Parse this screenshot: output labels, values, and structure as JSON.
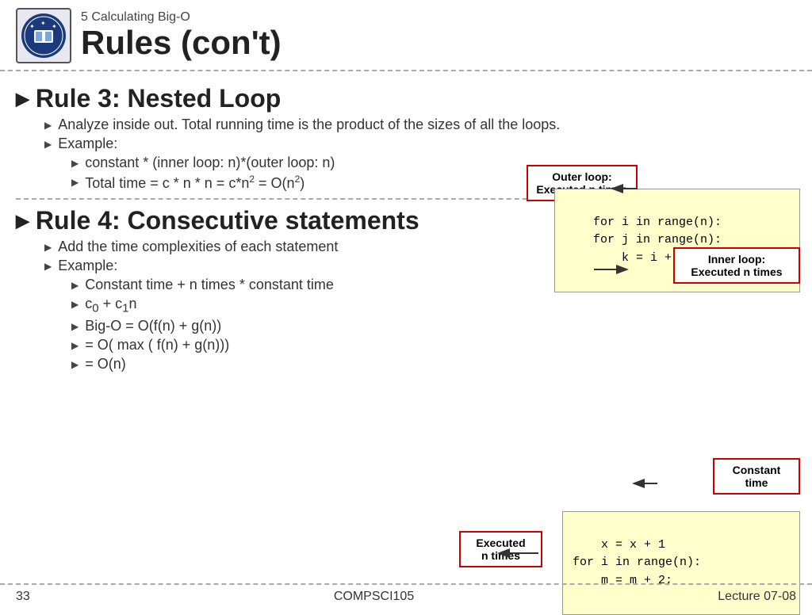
{
  "header": {
    "subtitle": "5 Calculating Big-O",
    "title": "Rules (con't)"
  },
  "rule3": {
    "heading": "Rule 3: Nested Loop",
    "bullet1": "Analyze inside out. Total running time is the product of the sizes of all the loops.",
    "bullet2": "Example:",
    "sub1": "constant * (inner loop: n)*(outer loop: n)",
    "sub2": "Total time = c * n * n = c*n² = O(n²)"
  },
  "rule4": {
    "heading": "Rule 4: Consecutive statements",
    "bullet1": "Add the time complexities of each statement",
    "bullet2": "Example:",
    "sub1": "Constant time + n times * constant time",
    "sub2": "c₀ + c₁n",
    "sub3": "Big-O = O(f(n) + g(n))",
    "sub4": "= O( max ( f(n) + g(n)))",
    "sub5": "= O(n)"
  },
  "callouts": {
    "outer_loop": "Outer loop:\nExecuted n times",
    "inner_loop": "Inner loop:\nExecuted n times",
    "constant_time": "Constant\ntime",
    "executed_n": "Executed\nn times"
  },
  "code": {
    "nested": "for i in range(n):\n    for j in range(n):\n        k = i + j",
    "consecutive": "x = x + 1\nfor i in range(n):\n    m = m + 2;"
  },
  "footer": {
    "page": "33",
    "course": "COMPSCI105",
    "lecture": "Lecture 07-08"
  }
}
